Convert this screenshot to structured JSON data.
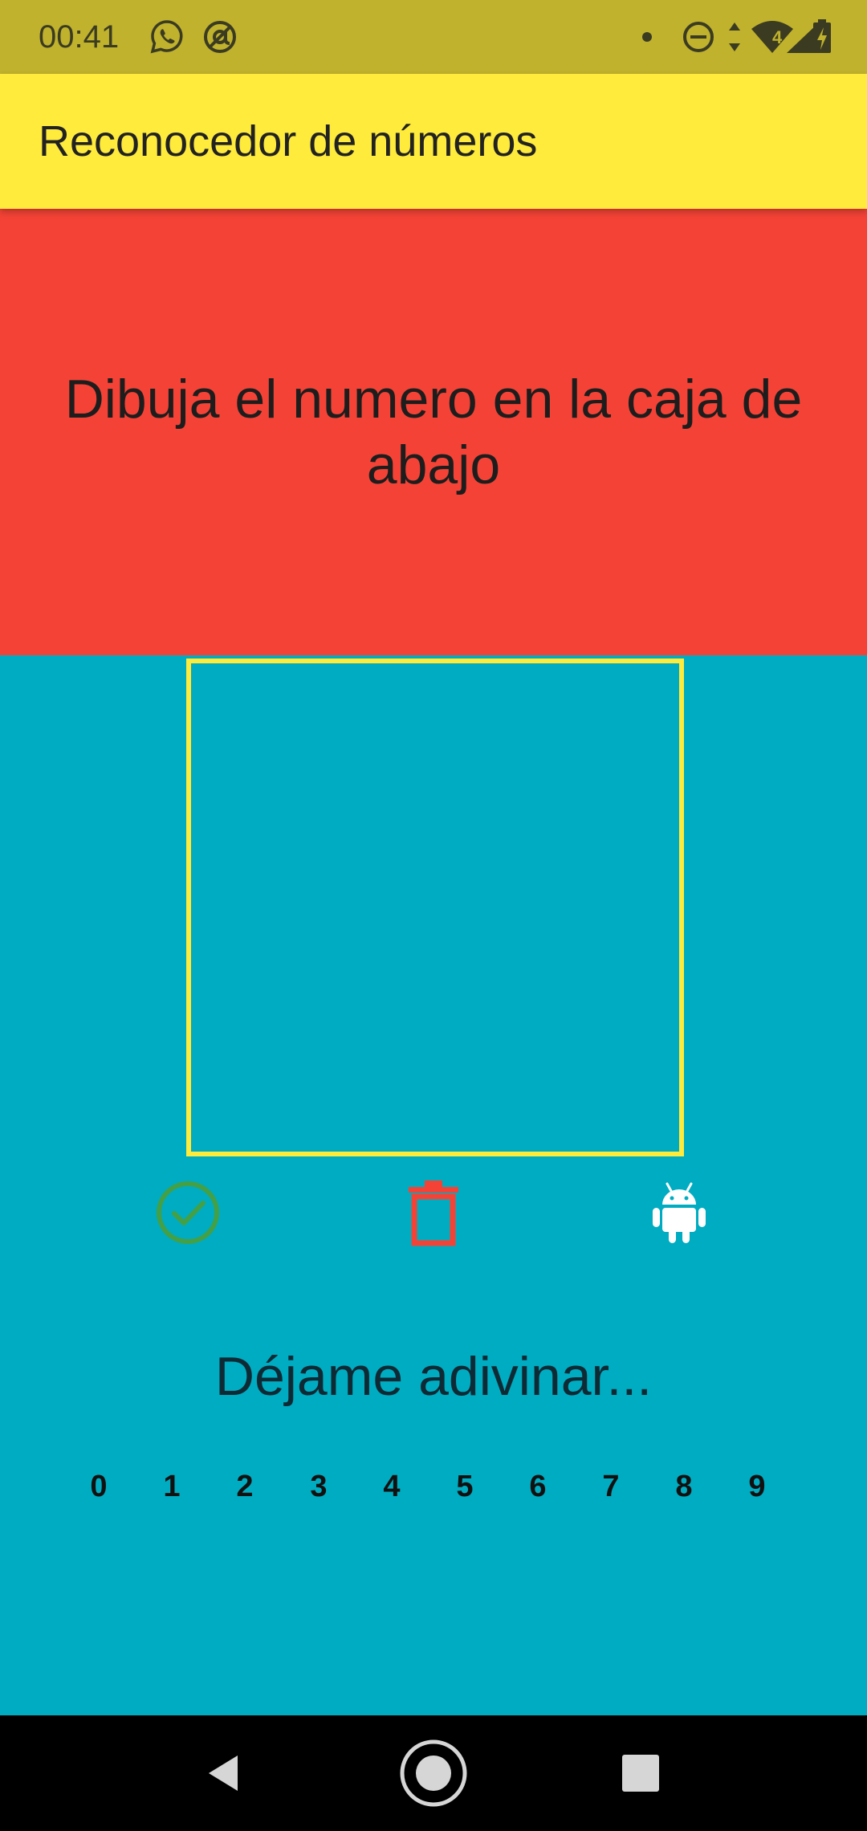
{
  "status_bar": {
    "time": "00:41",
    "icons": [
      "whatsapp-icon",
      "at-sign-icon",
      "notification-dot-icon",
      "do-not-disturb-icon",
      "data-arrows-icon",
      "wifi-icon",
      "signal-icon",
      "battery-charging-icon"
    ],
    "network_badge": "4"
  },
  "app_bar": {
    "title": "Reconocedor de números"
  },
  "instruction": {
    "text": "Dibuja el numero en la caja de abajo"
  },
  "actions": {
    "confirm_icon": "check-circle-icon",
    "clear_icon": "trash-icon",
    "predict_icon": "android-icon"
  },
  "result": {
    "guess_label": "Déjame adivinar...",
    "digits": [
      "0",
      "1",
      "2",
      "3",
      "4",
      "5",
      "6",
      "7",
      "8",
      "9"
    ]
  },
  "colors": {
    "status_bar": "#c0b22c",
    "app_bar": "#ffeb3b",
    "instruction_bg": "#f44336",
    "body_bg": "#00acc1",
    "canvas_border": "#ffeb3b",
    "confirm": "#43a047",
    "clear": "#f44336",
    "predict": "#ffffff"
  },
  "nav_bar": {
    "icons": [
      "back-icon",
      "home-icon",
      "recents-icon"
    ]
  }
}
